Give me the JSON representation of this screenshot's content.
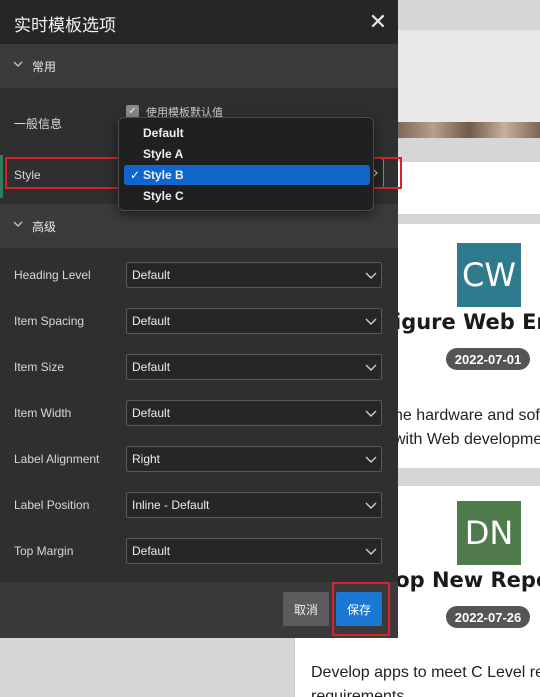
{
  "dialog": {
    "title": "实时模板选项",
    "sections": {
      "common": "常用",
      "advanced": "高级"
    },
    "general_info": {
      "label": "一般信息",
      "checkbox_label": "使用模板默认值",
      "checked": true
    },
    "style": {
      "label": "Style",
      "selected": "Style B",
      "options": [
        "Default",
        "Style A",
        "Style B",
        "Style C"
      ]
    },
    "fields": [
      {
        "label": "Heading Level",
        "value": "Default"
      },
      {
        "label": "Item Spacing",
        "value": "Default"
      },
      {
        "label": "Item Size",
        "value": "Default"
      },
      {
        "label": "Item Width",
        "value": "Default"
      },
      {
        "label": "Label Alignment",
        "value": "Right"
      },
      {
        "label": "Label Position",
        "value": "Inline - Default"
      },
      {
        "label": "Top Margin",
        "value": "Default"
      }
    ],
    "buttons": {
      "cancel": "取消",
      "save": "保存"
    },
    "close_glyph": "✕"
  },
  "background": {
    "cards": [
      {
        "initials": "CW",
        "avatar_color": "#2f7b8d",
        "title": "igure Web Envi",
        "date": "2022-07-01",
        "text_lines": [
          "he hardware and sof",
          "with Web developme"
        ]
      },
      {
        "initials": "DN",
        "avatar_color": "#4e7a4c",
        "title": "lop New Report",
        "date": "2022-07-26",
        "text_lines": [
          "Develop apps to meet C Level re",
          "requirements"
        ]
      }
    ]
  },
  "colors": {
    "accent": "#1a77d2",
    "highlight": "#d8232a",
    "dropdown_selected": "#1166cc"
  }
}
